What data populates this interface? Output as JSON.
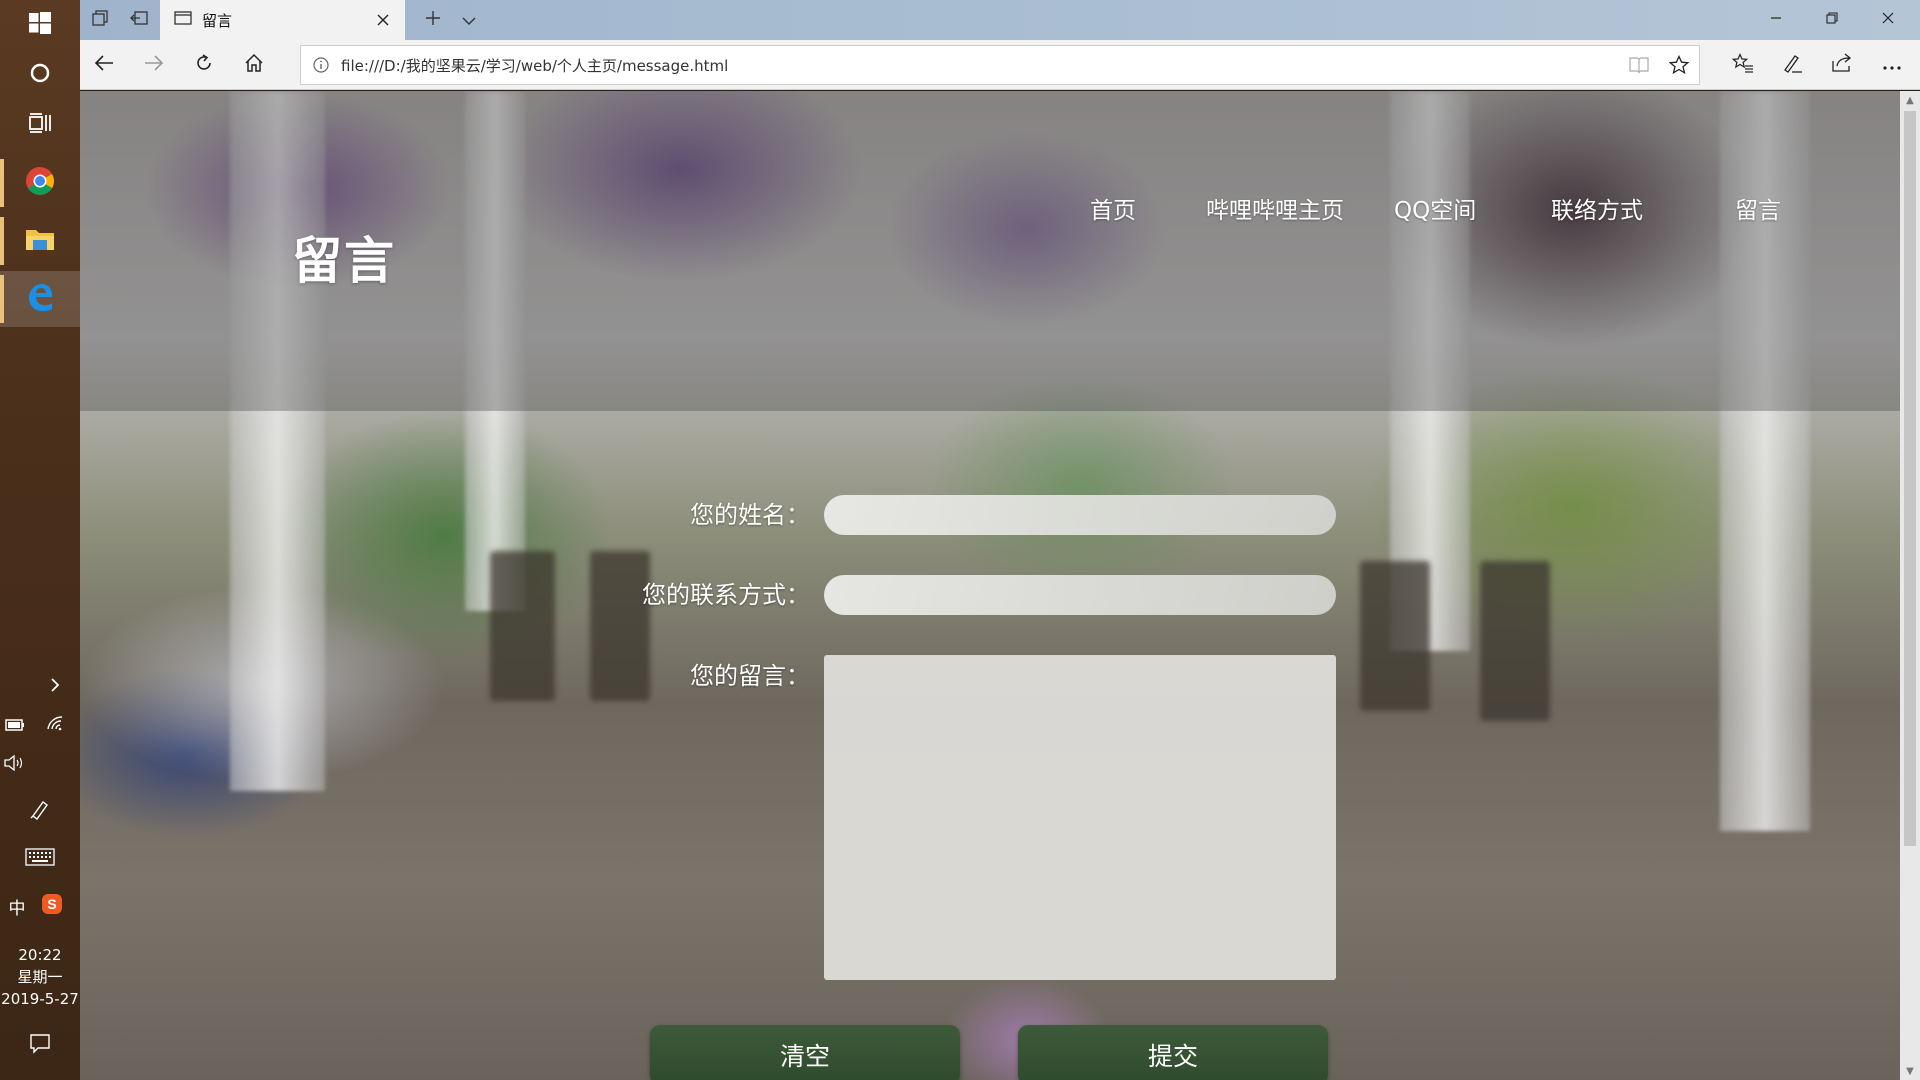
{
  "taskbar": {
    "apps": [
      {
        "name": "Chrome",
        "icon": "chrome-icon"
      },
      {
        "name": "File Explorer",
        "icon": "folder-icon"
      },
      {
        "name": "Microsoft Edge",
        "icon": "edge-icon"
      }
    ],
    "ime_label": "中",
    "clock": {
      "time": "20:22",
      "weekday": "星期一",
      "date": "2019-5-27"
    }
  },
  "browser": {
    "tab_title": "留言",
    "address": "file:///D:/我的坚果云/学习/web/个人主页/message.html"
  },
  "page": {
    "title": "留言",
    "nav": [
      "首页",
      "哔哩哔哩主页",
      "QQ空间",
      "联络方式",
      "留言"
    ],
    "form": {
      "name_label": "您的姓名：",
      "contact_label": "您的联系方式：",
      "message_label": "您的留言：",
      "name_value": "",
      "contact_value": "",
      "message_value": "",
      "clear_button": "清空",
      "submit_button": "提交"
    }
  },
  "colors": {
    "button_green": "#2e4a2c",
    "taskbar_brown": "#4a2f1b",
    "tabbar_blue": "#a9bdd2"
  }
}
